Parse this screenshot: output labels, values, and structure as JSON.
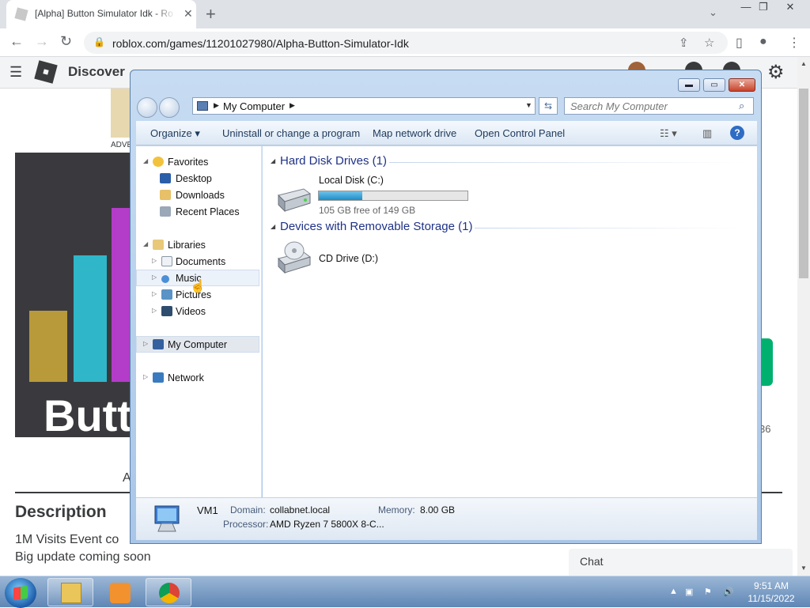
{
  "browser": {
    "tab_title": "[Alpha] Button Simulator Idk - Ro",
    "tab_close": "✕",
    "new_tab": "+",
    "url": "roblox.com/games/11201027980/Alpha-Button-Simulator-Idk",
    "window_controls": {
      "minimize": "—",
      "restore": "❐",
      "close": "✕"
    }
  },
  "roblox": {
    "nav_first": "Discover",
    "thumb_label": "ADVE",
    "hero_word": "Butt",
    "tab_first_letter": "A",
    "description_title": "Description",
    "description_lines": [
      "1M Visits Event co",
      "Big update coming soon"
    ],
    "side_count": "36",
    "chat_label": "Chat"
  },
  "explorer": {
    "address": {
      "root": "My Computer"
    },
    "search_placeholder": "Search My Computer",
    "commands": {
      "organize": "Organize ▾",
      "uninstall": "Uninstall or change a program",
      "map_drive": "Map network drive",
      "control_panel": "Open Control Panel"
    },
    "nav": {
      "favorites": "Favorites",
      "desktop": "Desktop",
      "downloads": "Downloads",
      "recent": "Recent Places",
      "libraries": "Libraries",
      "documents": "Documents",
      "music": "Music",
      "pictures": "Pictures",
      "videos": "Videos",
      "my_computer": "My Computer",
      "network": "Network"
    },
    "groups": {
      "hdd_header": "Hard Disk Drives (1)",
      "removable_header": "Devices with Removable Storage (1)"
    },
    "drives": {
      "c_name": "Local Disk (C:)",
      "c_free": "105 GB free of 149 GB",
      "c_used_fraction": 0.295,
      "d_name": "CD Drive (D:)"
    },
    "details": {
      "computer_name": "VM1",
      "domain_label": "Domain:",
      "domain_value": "collabnet.local",
      "memory_label": "Memory:",
      "memory_value": "8.00 GB",
      "processor_label": "Processor:",
      "processor_value": "AMD Ryzen 7 5800X 8-C..."
    }
  },
  "taskbar": {
    "time": "9:51 AM",
    "date": "11/15/2022"
  },
  "colors": {
    "roblox_green": "#00b06f",
    "explorer_frame": "#a9c6e8",
    "taskbar": "#5f86b5"
  }
}
